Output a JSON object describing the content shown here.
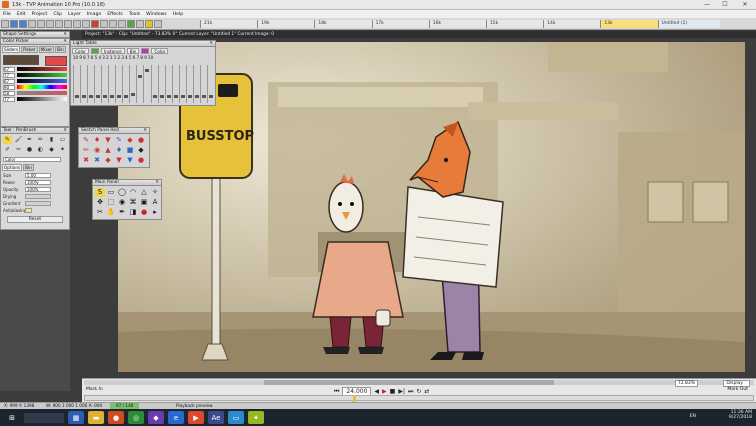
{
  "window": {
    "title": "13k - TVP Animation 10 Pro (10.0.18)",
    "controls": [
      "—",
      "☐",
      "✕"
    ]
  },
  "menu": [
    "File",
    "Edit",
    "Project",
    "Clip",
    "Layer",
    "Image",
    "Effects",
    "Tools",
    "Windows",
    "Help"
  ],
  "toolbar": {
    "frames": [
      "21k",
      "19k",
      "18k",
      "17k",
      "16k",
      "15k",
      "14k",
      "13k",
      "Untitled (1)"
    ],
    "active_frame_index": 7
  },
  "project_info": "Project: \"13k\" - Clip: \"Untitled\" - 73.83%  0°  Current Layer: \"Untitled 1\"  Current Image: 0",
  "shape_settings": {
    "title": "Shape Settings"
  },
  "color_picker": {
    "title": "Color Picker",
    "tabs": [
      "Sliders",
      "Picker",
      "Mixer",
      "Bin"
    ],
    "active_tab": "Sliders",
    "values": [
      "67",
      "77",
      "67",
      "90",
      "58",
      "77"
    ]
  },
  "tools_panel": {
    "title": "Tool : PenBrush",
    "color_select": "Color",
    "option_tabs": [
      "Options",
      "Bin"
    ],
    "active_tab": "Options",
    "fields": [
      {
        "label": "Size",
        "value": "5.00"
      },
      {
        "label": "Power",
        "value": "100%"
      },
      {
        "label": "Opacity",
        "value": "100%"
      },
      {
        "label": "Drying",
        "value": ""
      },
      {
        "label": "Gradient",
        "value": ""
      },
      {
        "label": "Antialiasing",
        "value": ""
      }
    ],
    "reset_label": "Reset"
  },
  "light_table": {
    "title": "Light Table",
    "mode": "Color",
    "instance": "Instance",
    "bin": "Bin",
    "color_label": "Color",
    "numbers": "10 9 8 7 6 5 4 3 2 1 1 2 3 4 5 6 7 8 9 10"
  },
  "sketch_panel": {
    "title": "Sketch Panel Red"
  },
  "main_panel": {
    "title": "Main Panel"
  },
  "transport": {
    "mark_in": "Mark In",
    "mark_out": "Mark Out",
    "zoom": "72.83%",
    "display": "Display",
    "fps": "24.000"
  },
  "status": {
    "coords": "X: 999   Y: 1398",
    "size": "W: 900   1 000   1 000  A: 000",
    "progress": "97 / 146",
    "mode": "Playback preview"
  },
  "taskbar": {
    "lang": "EN",
    "time": "11:36 AM",
    "date": "9/27/2018"
  },
  "scene": {
    "sign_text": "BUSSTOP"
  }
}
